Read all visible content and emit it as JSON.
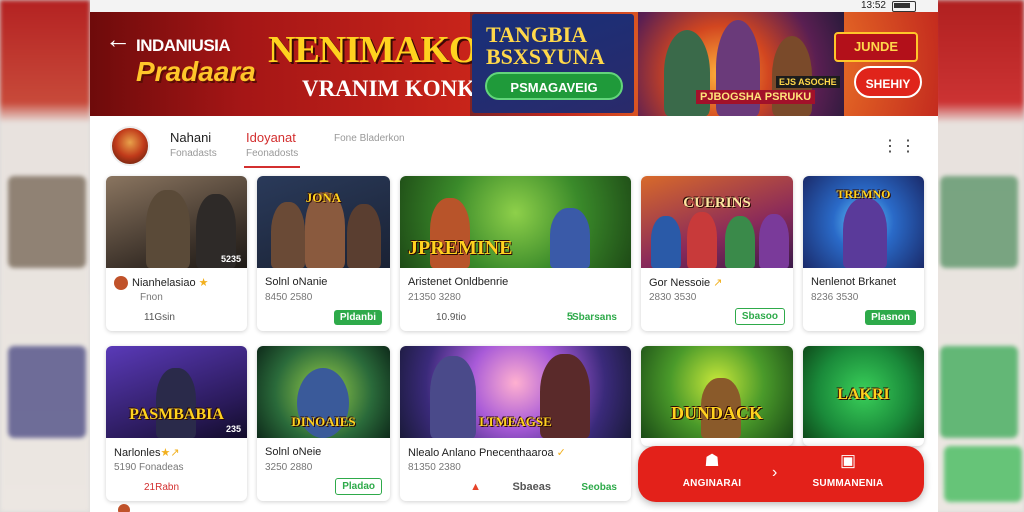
{
  "status": {
    "time": "13:52"
  },
  "banner": {
    "brand_line1": "INDANIUSIA",
    "brand_line2": "Pradaara",
    "headline": "NENIMAKON",
    "subline": "VRANIM KONKAN",
    "promo_title": "TANGBIA\nBSXSYUNA",
    "promo_button": "PSMAGAVEIG",
    "hero_caption": "PJBOGSHA PSRUKU",
    "hero_badge": "EJS ASOCHE",
    "logo_badge": "JUNDE",
    "cta": "SHEHIY"
  },
  "tabs": [
    {
      "label": "Nahani",
      "sub": "Fonadasts",
      "active": false
    },
    {
      "label": "Idoyanat",
      "sub": "Feonadosts",
      "active": true
    },
    {
      "label": "",
      "sub": "Fone Bladerkon",
      "active": false
    }
  ],
  "cards": [
    {
      "name": "Nianhelasiao",
      "star": "★",
      "meta": "Fnon",
      "foot": "11Gsin",
      "button": "",
      "thumb_title": "",
      "thumb_num": "5235"
    },
    {
      "name": "Solnl oNanie",
      "star": "",
      "meta": "8450 2580",
      "foot": "",
      "button": "Pldanbi",
      "thumb_title": "JONA",
      "thumb_num": ""
    },
    {
      "name": "Aristenet Onldbenrie",
      "star": "",
      "meta": "21350 3280",
      "foot": "10.9tio",
      "button": "Sbarsans",
      "mini": "5",
      "thumb_title": "JPREMINE",
      "thumb_num": ""
    },
    {
      "name": "Gor Nessoie",
      "star": "↗",
      "meta": "2830 3530",
      "foot": "",
      "button": "Sbasoo",
      "thumb_title": "CUERINS",
      "thumb_num": ""
    },
    {
      "name": "Nenlenot Brkanet",
      "star": "",
      "meta": "8236 3530",
      "foot": "",
      "button": "Plasnon",
      "thumb_title": "TREMNO",
      "thumb_num": ""
    },
    {
      "name": "Narlonles",
      "star": "★↗",
      "meta": "5190 Fonadeas",
      "foot": "21Rabn",
      "button": "",
      "thumb_title": "PASMBABIA",
      "thumb_num": "235"
    },
    {
      "name": "Solnl oNeie",
      "star": "",
      "meta": "3250 2880",
      "foot": "",
      "button": "Pladao",
      "thumb_title": "DINOAIES",
      "thumb_num": ""
    },
    {
      "name": "Nlealo Anlano Pnecenthaaroa",
      "star": "✓",
      "meta": "81350 2380",
      "foot": "",
      "button": "Seobas",
      "mini": "Sbaeas",
      "warn": "▲",
      "thumb_title": "LTMEAGSE",
      "thumb_num": ""
    },
    {
      "name": "",
      "star": "",
      "meta": "",
      "foot": "",
      "button": "",
      "thumb_title": "DUNDACK",
      "thumb_num": ""
    },
    {
      "name": "",
      "star": "",
      "meta": "",
      "foot": "",
      "button": "",
      "thumb_title": "LAKRI",
      "thumb_num": ""
    }
  ],
  "bottom_bar": {
    "left_label": "ANGINARAI",
    "right_label": "SUMMANENIA",
    "left_icon": "home-icon",
    "right_icon": "bookmark-icon"
  },
  "colors": {
    "accent": "#e3211a",
    "success": "#2eaa4a",
    "active_tab": "#d32f2f"
  }
}
